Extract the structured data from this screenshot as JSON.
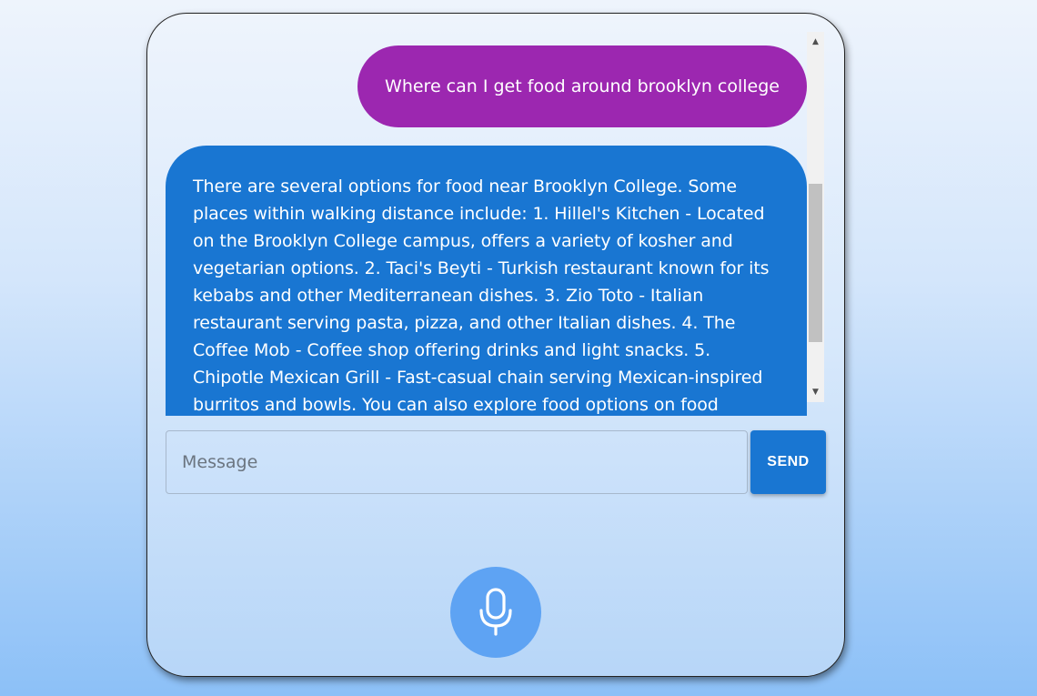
{
  "chat": {
    "messages": [
      {
        "role": "user",
        "text": "Where can I get food around brooklyn college"
      },
      {
        "role": "assistant",
        "text": "There are several options for food near Brooklyn College. Some places within walking distance include: 1. Hillel's Kitchen - Located on the Brooklyn College campus, offers a variety of kosher and vegetarian options. 2. Taci's Beyti - Turkish restaurant known for its kebabs and other Mediterranean dishes. 3. Zio Toto - Italian restaurant serving pasta, pizza, and other Italian dishes. 4. The Coffee Mob - Coffee shop offering drinks and light snacks. 5. Chipotle Mexican Grill - Fast-casual chain serving Mexican-inspired burritos and bowls. You can also explore food options on food"
      }
    ]
  },
  "composer": {
    "placeholder": "Message",
    "value": "",
    "send_label": "SEND"
  },
  "icons": {
    "mic": "microphone-icon",
    "scroll_up": "scroll-up-arrow-icon",
    "scroll_down": "scroll-down-arrow-icon"
  },
  "colors": {
    "user_bubble": "#9c27b0",
    "assistant_bubble": "#1976d2",
    "send_button": "#1976d2",
    "mic_button": "#5ea3f3"
  }
}
